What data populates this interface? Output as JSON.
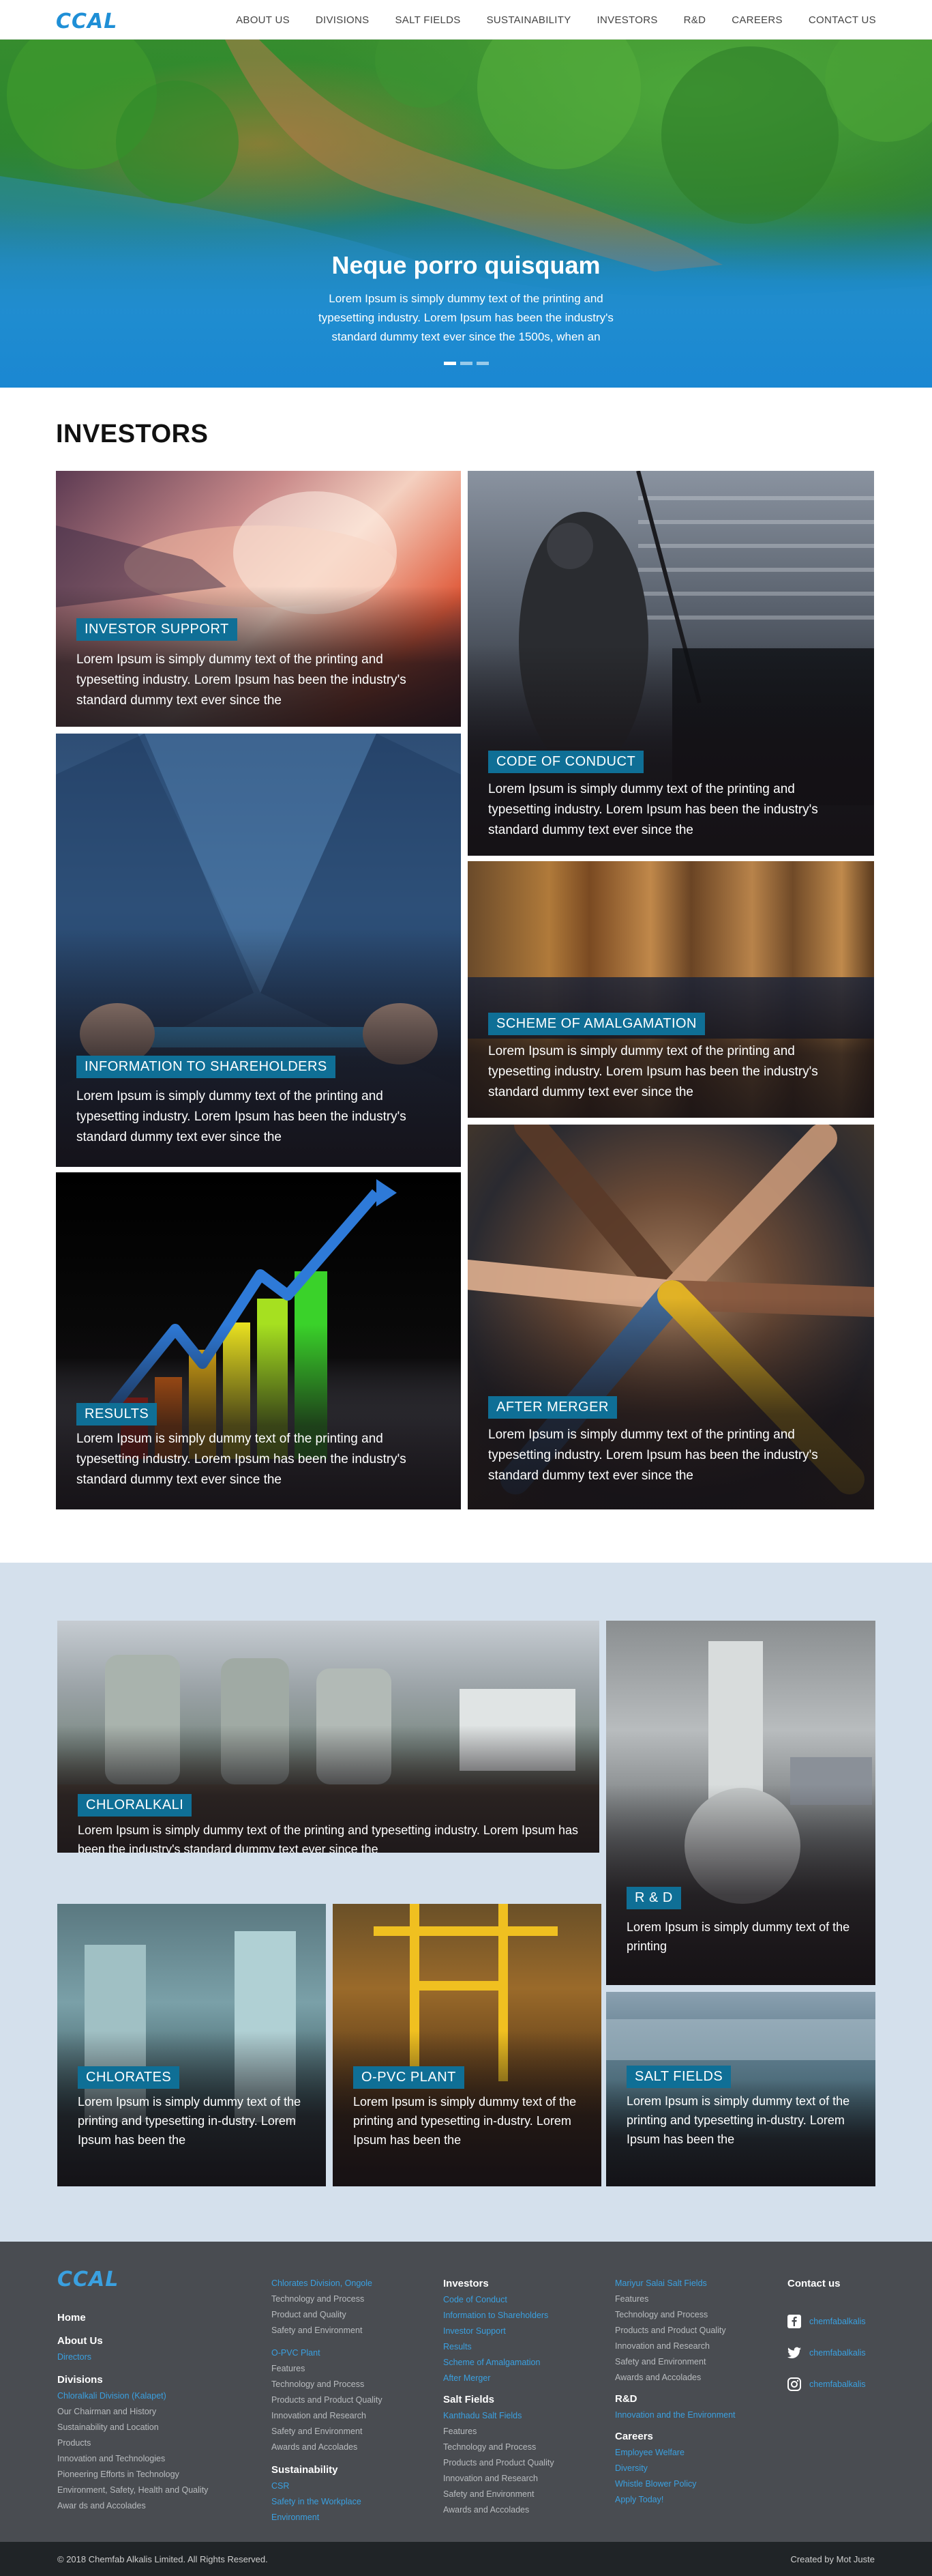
{
  "header": {
    "logo": "CCAL",
    "nav": [
      "ABOUT US",
      "DIVISIONS",
      "SALT FIELDS",
      "SUSTAINABILITY",
      "INVESTORS",
      "R&D",
      "CAREERS",
      "CONTACT US"
    ]
  },
  "hero": {
    "title": "Neque porro quisquam",
    "text": "Lorem Ipsum is simply dummy text of the printing and typesetting industry. Lorem Ipsum has been the industry's standard dummy text ever since the 1500s, when an",
    "slides": 3,
    "active_slide": 0
  },
  "investors": {
    "title": "INVESTORS",
    "tiles": [
      {
        "label": "INVESTOR SUPPORT",
        "text": "Lorem Ipsum is simply dummy text of the printing and typesetting industry. Lorem Ipsum has been the industry's standard dummy text ever since the"
      },
      {
        "label": "CODE OF CONDUCT",
        "text": "Lorem Ipsum is simply dummy text of the printing and typesetting industry. Lorem Ipsum has been the industry's standard dummy text ever since the"
      },
      {
        "label": "INFORMATION TO SHAREHOLDERS",
        "text": "Lorem Ipsum is simply dummy text of the printing and typesetting industry. Lorem Ipsum has been the industry's standard dummy text ever since the"
      },
      {
        "label": "SCHEME OF AMALGAMATION",
        "text": "Lorem Ipsum is simply dummy text of the printing and typesetting industry. Lorem Ipsum has been the industry's standard dummy text ever since the"
      },
      {
        "label": "RESULTS",
        "text": "Lorem Ipsum is simply dummy text of the printing and typesetting industry. Lorem Ipsum has been the industry's standard dummy text ever since the"
      },
      {
        "label": "AFTER MERGER",
        "text": "Lorem Ipsum is simply dummy text of the printing and typesetting industry. Lorem Ipsum has been the industry's standard dummy text ever since the"
      }
    ]
  },
  "divisions": {
    "tiles": [
      {
        "label": "CHLORALKALI",
        "text": "Lorem Ipsum is simply dummy text of the printing and typesetting industry. Lorem Ipsum has been the industry's standard dummy text ever since the"
      },
      {
        "label": "R & D",
        "text": "Lorem Ipsum is simply dummy text of the printing"
      },
      {
        "label": "CHLORATES",
        "text": "Lorem Ipsum is simply dummy text of the printing and typesetting in-dustry. Lorem Ipsum has been the"
      },
      {
        "label": "O-PVC PLANT",
        "text": "Lorem Ipsum is simply dummy text of the printing and typesetting in-dustry. Lorem Ipsum has been the"
      },
      {
        "label": "SALT FIELDS",
        "text": "Lorem Ipsum is simply dummy text of the printing and typesetting in-dustry. Lorem Ipsum has been the"
      }
    ]
  },
  "footer": {
    "logo": "CCAL",
    "col1": {
      "home": "Home",
      "about": "About Us",
      "about_links": [
        "Directors"
      ],
      "divisions": "Divisions",
      "divisions_link": "Chloralkali Division (Kalapet)",
      "divisions_items": [
        "Our Chairman and History",
        "Sustainability and Location",
        "Products",
        "Innovation and Technologies",
        "Pioneering Efforts in Technology",
        "Environment, Safety, Health and Quality",
        "Awar ds and Accolades"
      ]
    },
    "col2": {
      "link1": "Chlorates Division, Ongole",
      "items1": [
        "Technology and Process",
        "Product and Quality",
        "Safety and Environment"
      ],
      "link2": "O-PVC Plant",
      "items2": [
        "Features",
        "Technology and Process",
        "Products and Product Quality",
        "Innovation and Research",
        "Safety and Environment",
        "Awards and Accolades"
      ],
      "sustainability": "Sustainability",
      "sustainability_links": [
        "CSR",
        "Safety in the Workplace",
        "Environment"
      ]
    },
    "col3": {
      "investors": "Investors",
      "investors_links": [
        "Code of Conduct",
        "Information to Shareholders",
        "Investor Support",
        "Results",
        "Scheme of Amalgamation",
        "After Merger"
      ],
      "salt": "Salt Fields",
      "salt_link": "Kanthadu Salt Fields",
      "salt_items": [
        "Features",
        "Technology and Process",
        "Products and Product Quality",
        "Innovation and Research",
        "Safety and Environment",
        "Awards and Accolades"
      ]
    },
    "col4": {
      "link1": "Mariyur Salai Salt Fields",
      "items1": [
        "Features",
        "Technology and Process",
        "Products and Product Quality",
        "Innovation and Research",
        "Safety and Environment",
        "Awards and Accolades"
      ],
      "rd": "R&D",
      "rd_links": [
        "Innovation and the Environment"
      ],
      "careers": "Careers",
      "careers_links": [
        "Employee Welfare",
        "Diversity",
        "Whistle Blower Policy",
        "Apply Today!"
      ]
    },
    "contact": {
      "title": "Contact us",
      "facebook": "chemfabalkalis",
      "twitter": "chemfabalkalis",
      "instagram": "chemfabalkalis"
    },
    "copyright": "© 2018 Chemfab Alkalis Limited. All Rights Reserved.",
    "credit": "Created by Mot Juste"
  }
}
